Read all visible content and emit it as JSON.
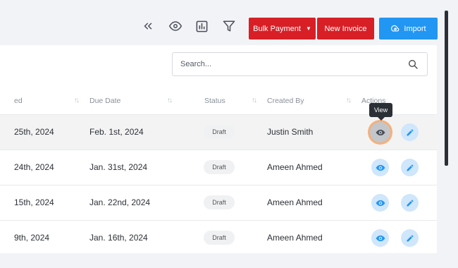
{
  "toolbar": {
    "icons": [
      "chevrons-left-icon",
      "eye-icon",
      "bar-chart-icon",
      "filter-icon"
    ],
    "bulk_payment_label": "Bulk Payment",
    "new_invoice_label": "New Invoice",
    "import_label": "Import"
  },
  "search": {
    "placeholder": "Search..."
  },
  "table": {
    "columns": [
      "ed",
      "Due Date",
      "Status",
      "Created By",
      "Actions"
    ],
    "rows": [
      {
        "date": "25th, 2024",
        "due_date": "Feb. 1st, 2024",
        "status": "Draft",
        "created_by": "Justin Smith"
      },
      {
        "date": "24th, 2024",
        "due_date": "Jan. 31st, 2024",
        "status": "Draft",
        "created_by": "Ameen Ahmed"
      },
      {
        "date": "15th, 2024",
        "due_date": "Jan. 22nd, 2024",
        "status": "Draft",
        "created_by": "Ameen Ahmed"
      },
      {
        "date": "9th, 2024",
        "due_date": "Jan. 16th, 2024",
        "status": "Draft",
        "created_by": "Ameen Ahmed"
      }
    ]
  },
  "tooltip": {
    "text": "View"
  },
  "colors": {
    "primary_red": "#d81f26",
    "primary_blue": "#2196f3",
    "highlight_ring": "#f6b07a"
  }
}
